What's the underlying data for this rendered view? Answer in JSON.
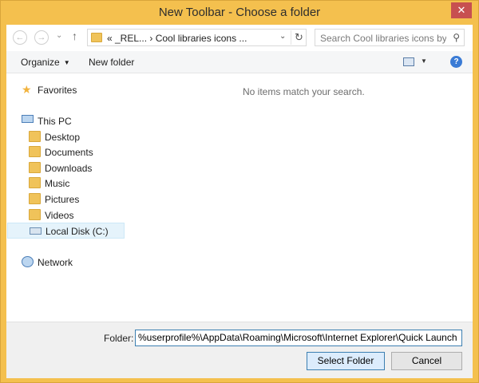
{
  "window": {
    "title": "New Toolbar - Choose a folder",
    "close_glyph": "✕"
  },
  "address": {
    "path": "«  _REL...  ›  Cool libraries icons ...",
    "dropdown_glyph": "⌄",
    "refresh_glyph": "↻"
  },
  "search": {
    "placeholder": "Search Cool libraries icons by ..."
  },
  "toolbar": {
    "organize_label": "Organize",
    "new_folder_label": "New folder",
    "help_glyph": "?"
  },
  "navpane": {
    "favorites": "Favorites",
    "this_pc": "This PC",
    "items": [
      "Desktop",
      "Documents",
      "Downloads",
      "Music",
      "Pictures",
      "Videos",
      "Local Disk (C:)"
    ],
    "network": "Network"
  },
  "content": {
    "empty_message": "No items match your search."
  },
  "footer": {
    "folder_label": "Folder:",
    "folder_value": "%userprofile%\\AppData\\Roaming\\Microsoft\\Internet Explorer\\Quick Launch",
    "select_label": "Select Folder",
    "cancel_label": "Cancel"
  },
  "colors": {
    "frame": "#f4c04e",
    "accent": "#3c7fb1",
    "selected_bg": "#e5f3fb"
  }
}
